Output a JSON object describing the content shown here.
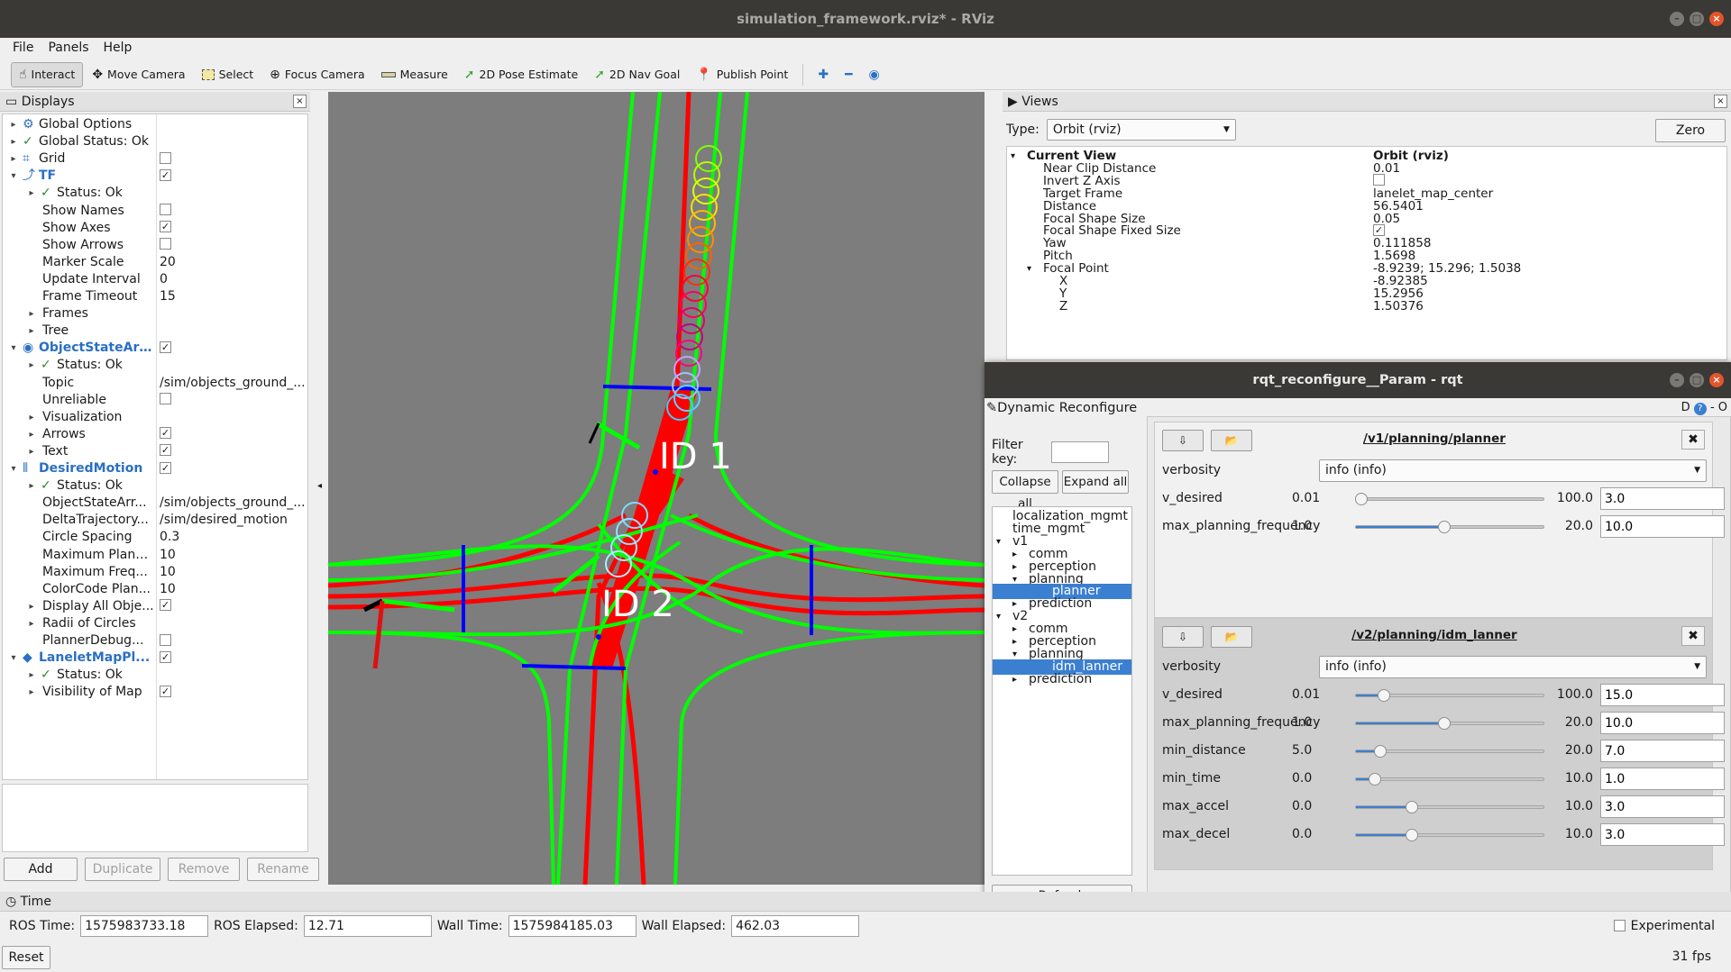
{
  "window": {
    "title": "simulation_framework.rviz* - RViz"
  },
  "menu": [
    "File",
    "Panels",
    "Help"
  ],
  "toolbar": {
    "tools": [
      {
        "label": "Interact",
        "icon": "hand-icon",
        "active": true
      },
      {
        "label": "Move Camera",
        "icon": "move-camera-icon"
      },
      {
        "label": "Select",
        "icon": "select-icon"
      },
      {
        "label": "Focus Camera",
        "icon": "focus-camera-icon"
      },
      {
        "label": "Measure",
        "icon": "ruler-icon"
      },
      {
        "label": "2D Pose Estimate",
        "icon": "arrow-green-icon"
      },
      {
        "label": "2D Nav Goal",
        "icon": "arrow-green-icon"
      },
      {
        "label": "Publish Point",
        "icon": "pin-icon"
      }
    ]
  },
  "displays": {
    "title": "Displays",
    "rows": [
      {
        "name": "Global Options",
        "value": "",
        "indent": 0,
        "exp": "▸",
        "icon": "⚙"
      },
      {
        "name": "Global Status: Ok",
        "value": "",
        "indent": 0,
        "exp": "▸",
        "icon": "✓"
      },
      {
        "name": "Grid",
        "value": "",
        "indent": 0,
        "exp": "▸",
        "icon": "⌗",
        "check": false
      },
      {
        "name": "TF",
        "value": "",
        "indent": 0,
        "exp": "▾",
        "icon": "⤴",
        "check": true,
        "blue": true
      },
      {
        "name": "Status: Ok",
        "value": "",
        "indent": 1,
        "exp": "▸",
        "icon": "✓"
      },
      {
        "name": "Show Names",
        "value": "",
        "indent": 1,
        "check": false
      },
      {
        "name": "Show Axes",
        "value": "",
        "indent": 1,
        "check": true
      },
      {
        "name": "Show Arrows",
        "value": "",
        "indent": 1,
        "check": false
      },
      {
        "name": "Marker Scale",
        "value": "20",
        "indent": 1
      },
      {
        "name": "Update Interval",
        "value": "0",
        "indent": 1
      },
      {
        "name": "Frame Timeout",
        "value": "15",
        "indent": 1
      },
      {
        "name": "Frames",
        "value": "",
        "indent": 1,
        "exp": "▸"
      },
      {
        "name": "Tree",
        "value": "",
        "indent": 1,
        "exp": "▸"
      },
      {
        "name": "ObjectStateArr...",
        "value": "",
        "indent": 0,
        "exp": "▾",
        "icon": "◉",
        "check": true,
        "blue": true
      },
      {
        "name": "Status: Ok",
        "value": "",
        "indent": 1,
        "exp": "▸",
        "icon": "✓"
      },
      {
        "name": "Topic",
        "value": "/sim/objects_ground_...",
        "indent": 1
      },
      {
        "name": "Unreliable",
        "value": "",
        "indent": 1,
        "check": false
      },
      {
        "name": "Visualization",
        "value": "",
        "indent": 1,
        "exp": "▸"
      },
      {
        "name": "Arrows",
        "value": "",
        "indent": 1,
        "exp": "▸",
        "check": true
      },
      {
        "name": "Text",
        "value": "",
        "indent": 1,
        "exp": "▸",
        "check": true
      },
      {
        "name": "DesiredMotion",
        "value": "",
        "indent": 0,
        "exp": "▾",
        "icon": "⦀",
        "check": true,
        "blue": true
      },
      {
        "name": "Status: Ok",
        "value": "",
        "indent": 1,
        "exp": "▸",
        "icon": "✓"
      },
      {
        "name": "ObjectStateArr...",
        "value": "/sim/objects_ground_...",
        "indent": 1
      },
      {
        "name": "DeltaTrajectory...",
        "value": "/sim/desired_motion",
        "indent": 1
      },
      {
        "name": "Circle Spacing",
        "value": "0.3",
        "indent": 1
      },
      {
        "name": "Maximum Plann...",
        "value": "10",
        "indent": 1
      },
      {
        "name": "Maximum Freq...",
        "value": "10",
        "indent": 1
      },
      {
        "name": "ColorCode Plan...",
        "value": "10",
        "indent": 1
      },
      {
        "name": "Display All Obje...",
        "value": "",
        "indent": 1,
        "exp": "▸",
        "check": true
      },
      {
        "name": "Radii of Circles",
        "value": "",
        "indent": 1,
        "exp": "▸"
      },
      {
        "name": "PlannerDebug...",
        "value": "",
        "indent": 1,
        "check": false
      },
      {
        "name": "LaneletMapPl...",
        "value": "",
        "indent": 0,
        "exp": "▾",
        "icon": "◆",
        "check": true,
        "blue": true
      },
      {
        "name": "Status: Ok",
        "value": "",
        "indent": 1,
        "exp": "▸",
        "icon": "✓"
      },
      {
        "name": "Visibility of Map",
        "value": "",
        "indent": 1,
        "exp": "▸",
        "check": true
      }
    ],
    "buttons": {
      "add": "Add",
      "duplicate": "Duplicate",
      "remove": "Remove",
      "rename": "Rename"
    }
  },
  "viewport": {
    "labels": [
      "ID 1",
      "ID 2"
    ]
  },
  "views": {
    "title": "Views",
    "type_label": "Type:",
    "type_value": "Orbit (rviz)",
    "zero": "Zero",
    "rows": [
      {
        "name": "Current View",
        "value": "Orbit (rviz)",
        "indent": 0,
        "bold": true,
        "exp": "▾"
      },
      {
        "name": "Near Clip Distance",
        "value": "0.01",
        "indent": 1
      },
      {
        "name": "Invert Z Axis",
        "value": "",
        "indent": 1,
        "check": false
      },
      {
        "name": "Target Frame",
        "value": "lanelet_map_center",
        "indent": 1
      },
      {
        "name": "Distance",
        "value": "56.5401",
        "indent": 1
      },
      {
        "name": "Focal Shape Size",
        "value": "0.05",
        "indent": 1
      },
      {
        "name": "Focal Shape Fixed Size",
        "value": "",
        "indent": 1,
        "check": true
      },
      {
        "name": "Yaw",
        "value": "0.111858",
        "indent": 1
      },
      {
        "name": "Pitch",
        "value": "1.5698",
        "indent": 1
      },
      {
        "name": "Focal Point",
        "value": "-8.9239; 15.296; 1.5038",
        "indent": 1,
        "exp": "▾"
      },
      {
        "name": "X",
        "value": "-8.92385",
        "indent": 2
      },
      {
        "name": "Y",
        "value": "15.2956",
        "indent": 2
      },
      {
        "name": "Z",
        "value": "1.50376",
        "indent": 2
      }
    ]
  },
  "rqt": {
    "title": "rqt_reconfigure__Param - rqt",
    "plugin": "Dynamic Reconfigure",
    "plugin_right": "D",
    "plugin_right_2": "- O",
    "filter_label": "Filter key:",
    "collapse": "Collapse all",
    "expand": "Expand all",
    "refresh": "Refresh",
    "tree": [
      {
        "name": "localization_mgmt",
        "indent": 0,
        "exp": ""
      },
      {
        "name": "time_mgmt",
        "indent": 0,
        "exp": ""
      },
      {
        "name": "v1",
        "indent": 0,
        "exp": "▾"
      },
      {
        "name": "comm",
        "indent": 1,
        "exp": "▸"
      },
      {
        "name": "perception",
        "indent": 1,
        "exp": "▸"
      },
      {
        "name": "planning",
        "indent": 1,
        "exp": "▾"
      },
      {
        "name": "planner",
        "indent": 2,
        "exp": "",
        "selected": true
      },
      {
        "name": "prediction",
        "indent": 1,
        "exp": "▸"
      },
      {
        "name": "v2",
        "indent": 0,
        "exp": "▾"
      },
      {
        "name": "comm",
        "indent": 1,
        "exp": "▸"
      },
      {
        "name": "perception",
        "indent": 1,
        "exp": "▸"
      },
      {
        "name": "planning",
        "indent": 1,
        "exp": "▾"
      },
      {
        "name": "idm_lanner",
        "indent": 2,
        "exp": "",
        "selected": true
      },
      {
        "name": "prediction",
        "indent": 1,
        "exp": "▸"
      }
    ],
    "groups": [
      {
        "title": "/v1/planning/planner",
        "verbosity_label": "verbosity",
        "verbosity_value": "info (info)",
        "params": [
          {
            "name": "v_desired",
            "min": "0.01",
            "max": "100.0",
            "value": "3.0",
            "fraction": 0.03
          },
          {
            "name": "max_planning_frequency",
            "min": "1.0",
            "max": "20.0",
            "value": "10.0",
            "fraction": 0.47
          }
        ]
      },
      {
        "title": "/v2/planning/idm_lanner",
        "verbosity_label": "verbosity",
        "verbosity_value": "info (info)",
        "params": [
          {
            "name": "v_desired",
            "min": "0.01",
            "max": "100.0",
            "value": "15.0",
            "fraction": 0.15
          },
          {
            "name": "max_planning_frequency",
            "min": "1.0",
            "max": "20.0",
            "value": "10.0",
            "fraction": 0.47
          },
          {
            "name": "min_distance",
            "min": "5.0",
            "max": "20.0",
            "value": "7.0",
            "fraction": 0.13
          },
          {
            "name": "min_time",
            "min": "0.0",
            "max": "10.0",
            "value": "1.0",
            "fraction": 0.1
          },
          {
            "name": "max_accel",
            "min": "0.0",
            "max": "10.0",
            "value": "3.0",
            "fraction": 0.3
          },
          {
            "name": "max_decel",
            "min": "0.0",
            "max": "10.0",
            "value": "3.0",
            "fraction": 0.3
          }
        ]
      }
    ]
  },
  "time": {
    "title": "Time",
    "ros_time_label": "ROS Time:",
    "ros_time": "1575983733.18",
    "ros_elapsed_label": "ROS Elapsed:",
    "ros_elapsed": "12.71",
    "wall_time_label": "Wall Time:",
    "wall_time": "1575984185.03",
    "wall_elapsed_label": "Wall Elapsed:",
    "wall_elapsed": "462.03",
    "experimental": "Experimental",
    "reset": "Reset",
    "fps": "31 fps"
  }
}
